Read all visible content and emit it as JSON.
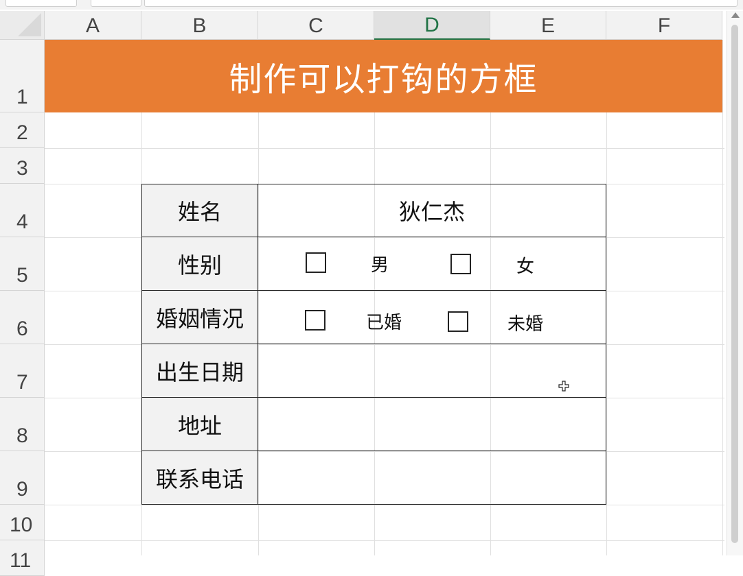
{
  "columns": [
    "A",
    "B",
    "C",
    "D",
    "E",
    "F"
  ],
  "active_column": "D",
  "rows": [
    "1",
    "2",
    "3",
    "4",
    "5",
    "6",
    "7",
    "8",
    "9",
    "10",
    "11"
  ],
  "title": "制作可以打钩的方框",
  "form": {
    "name_label": "姓名",
    "name_value": "狄仁杰",
    "gender_label": "性别",
    "gender_options": [
      "男",
      "女"
    ],
    "marital_label": "婚姻情况",
    "marital_options": [
      "已婚",
      "未婚"
    ],
    "birth_label": "出生日期",
    "address_label": "地址",
    "phone_label": "联系电话"
  },
  "colors": {
    "title_band": "#e87d33",
    "label_fill": "#f2f2f2",
    "active_header": "#217346"
  }
}
